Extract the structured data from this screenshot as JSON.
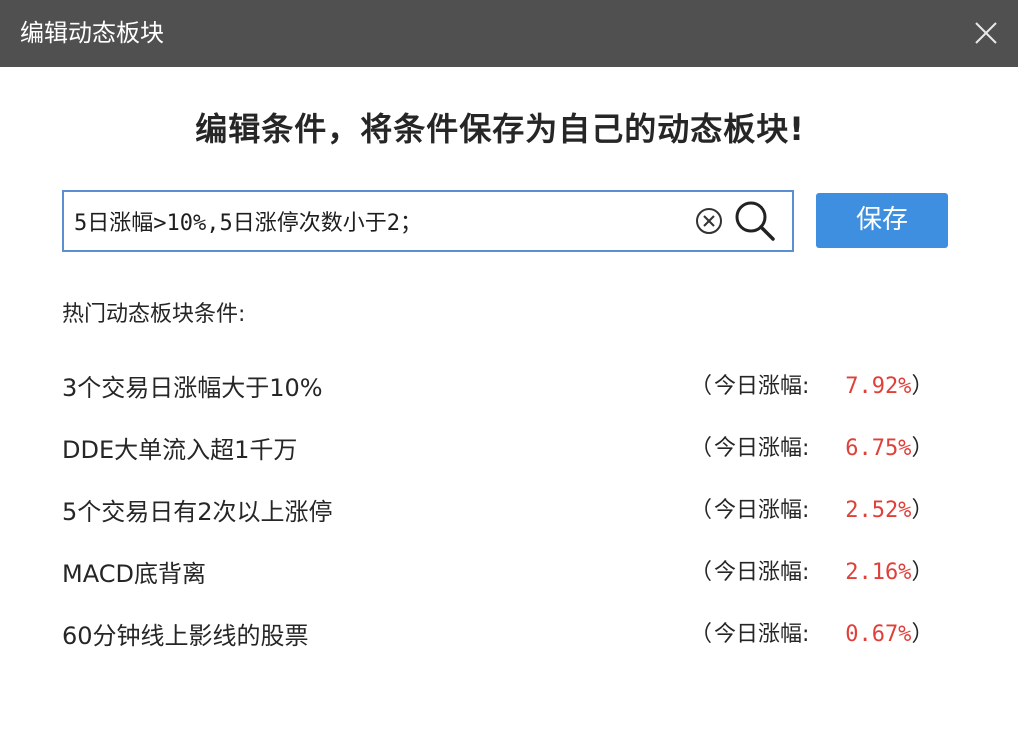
{
  "window": {
    "title": "编辑动态板块",
    "close_icon": "close-icon"
  },
  "heading": "编辑条件，将条件保存为自己的动态板块!",
  "search": {
    "value": "5日涨幅>10%,5日涨停次数小于2；",
    "placeholder": "",
    "accent": "#5b8fd4"
  },
  "save_label": "保存",
  "save_color": "#3f8fe0",
  "section_label": "热门动态板块条件:",
  "stat_left_paren": "（",
  "stat_label": "今日涨幅:",
  "stat_right_paren": "）",
  "value_color": "#e0403a",
  "conditions": [
    {
      "name": "3个交易日涨幅大于10%",
      "value": "7.92%"
    },
    {
      "name": "DDE大单流入超1千万",
      "value": "6.75%"
    },
    {
      "name": "5个交易日有2次以上涨停",
      "value": "2.52%"
    },
    {
      "name": "MACD底背离",
      "value": "2.16%"
    },
    {
      "name": "60分钟线上影线的股票",
      "value": "0.67%"
    }
  ]
}
